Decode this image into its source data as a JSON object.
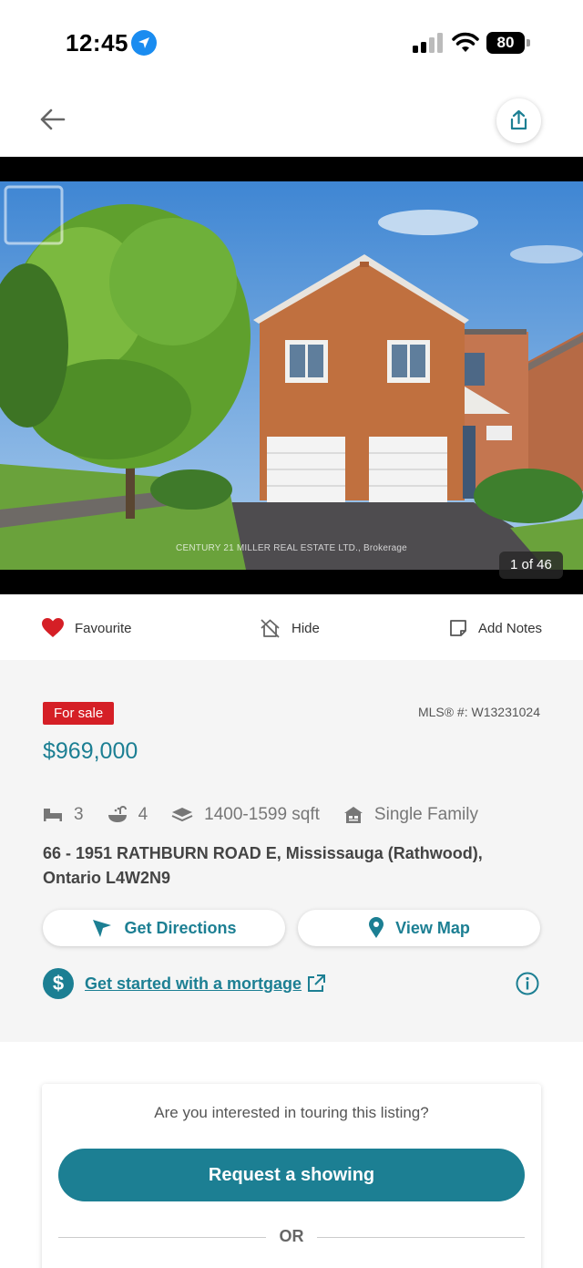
{
  "status_bar": {
    "time": "12:45",
    "battery": "80"
  },
  "listing": {
    "photo_counter": "1 of 46",
    "photo_credit": "CENTURY 21 MILLER REAL ESTATE LTD., Brokerage",
    "actions": {
      "favourite": "Favourite",
      "hide": "Hide",
      "add_notes": "Add Notes"
    },
    "status_badge": "For sale",
    "mls": "MLS® #: W13231024",
    "price": "$969,000",
    "specs": {
      "beds": "3",
      "baths": "4",
      "sqft": "1400-1599 sqft",
      "type": "Single Family"
    },
    "address": "66 - 1951 RATHBURN ROAD E, Mississauga (Rathwood), Ontario L4W2N9",
    "get_directions": "Get Directions",
    "view_map": "View Map",
    "mortgage_link": "Get started with a mortgage",
    "dollar_symbol": "$"
  },
  "tour": {
    "question": "Are you interested in touring this listing?",
    "request_button": "Request a showing",
    "or": "OR"
  },
  "colors": {
    "accent": "#1c7f93",
    "badge_red": "#d51f26",
    "favourite_red": "#d51f26"
  }
}
